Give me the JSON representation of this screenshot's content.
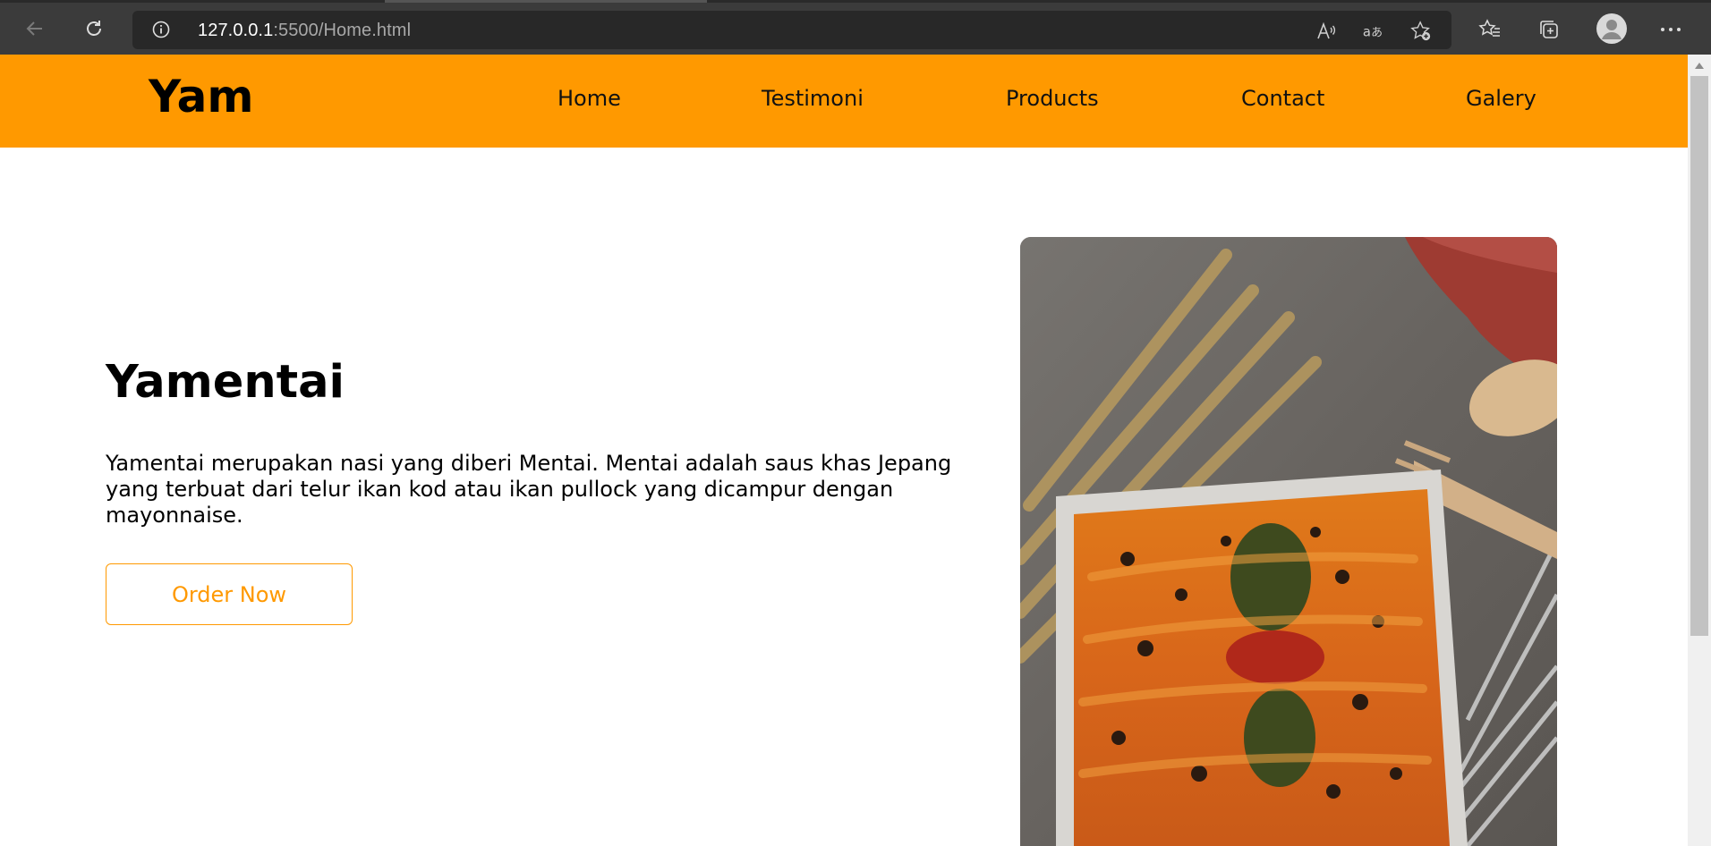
{
  "browser": {
    "url_host": "127.0.0.1",
    "url_rest": ":5500/Home.html",
    "icons": [
      "back-arrow-icon",
      "refresh-icon",
      "info-icon",
      "read-aloud-icon",
      "translate-icon",
      "add-favorite-icon",
      "favorites-icon",
      "collections-icon",
      "profile-avatar-icon",
      "more-icon"
    ]
  },
  "site": {
    "logo": "Yam",
    "nav": [
      "Home",
      "Testimoni",
      "Products",
      "Contact",
      "Galery"
    ],
    "brand_color": "#ff9900"
  },
  "hero": {
    "title": "Yamentai",
    "description": "Yamentai merupakan nasi yang diberi Mentai. Mentai adalah saus khas Jepang yang terbuat dari telur ikan kod atau ikan pullock yang dicampur dengan mayonnaise.",
    "cta": "Order Now"
  }
}
